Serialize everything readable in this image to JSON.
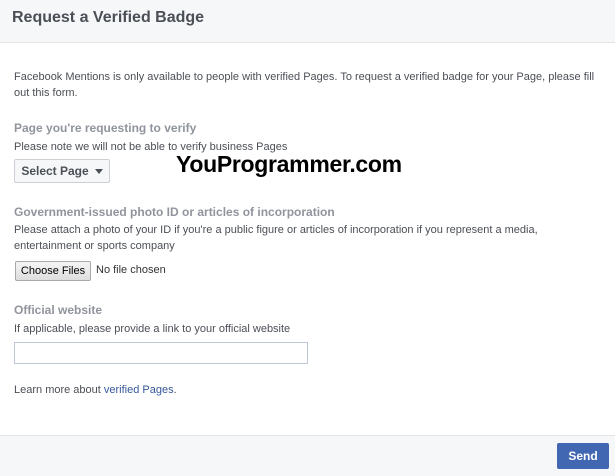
{
  "dialog": {
    "title": "Request a Verified Badge",
    "intro": "Facebook Mentions is only available to people with verified Pages. To request a verified badge for your Page, please fill out this form."
  },
  "page_section": {
    "title": "Page you're requesting to verify",
    "note": "Please note we will not be able to verify business Pages",
    "select_label": "Select Page"
  },
  "watermark": "YouProgrammer.com",
  "id_section": {
    "title": "Government-issued photo ID or articles of incorporation",
    "note": "Please attach a photo of your ID if you're a public figure or articles of incorporation if you represent a media, entertainment or sports company",
    "choose_label": "Choose Files",
    "no_file_label": "No file chosen"
  },
  "website_section": {
    "title": "Official website",
    "note": "If applicable, please provide a link to your official website",
    "value": ""
  },
  "learn_more": {
    "prefix": "Learn more about ",
    "link": "verified Pages",
    "suffix": "."
  },
  "footer": {
    "send_label": "Send"
  }
}
